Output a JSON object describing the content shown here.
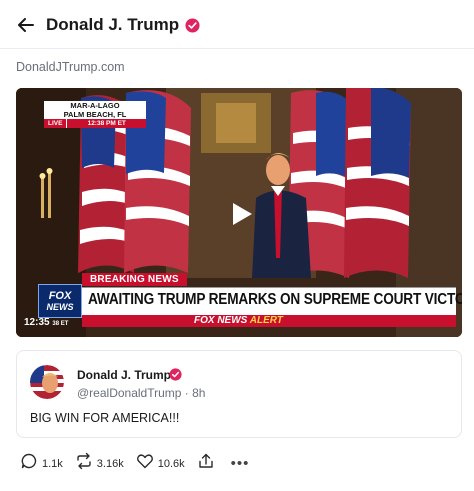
{
  "header": {
    "title": "Donald J. Trump",
    "back_icon": "arrow-left-icon",
    "verified_icon": "verified-badge-icon"
  },
  "site_link": "DonaldJTrump.com",
  "video": {
    "location_line1": "MAR-A-LAGO",
    "location_line2": "PALM BEACH, FL",
    "live_label": "LIVE",
    "live_time": "12:38 PM ET",
    "breaking_label": "BREAKING NEWS",
    "headline": "AWAITING TRUMP REMARKS ON SUPREME COURT VICTORY",
    "alert_brand": "FOX NEWS",
    "alert_word": "ALERT",
    "logo_line1": "FOX",
    "logo_line2": "NEWS",
    "clock": "12:35",
    "clock_suffix": "38 ET",
    "play_icon": "play-icon"
  },
  "post": {
    "name": "Donald J. Trump",
    "handle_time": "@realDonaldTrump · 8h",
    "text": "BIG WIN FOR AMERICA!!!"
  },
  "actions": {
    "replies": "1.1k",
    "reposts": "3.16k",
    "likes": "10.6k",
    "more": "•••"
  },
  "colors": {
    "verified": "#e0245e",
    "fox_red": "#c8102e",
    "fox_blue": "#0b2a6b",
    "muted_text": "#6a6f7b"
  }
}
